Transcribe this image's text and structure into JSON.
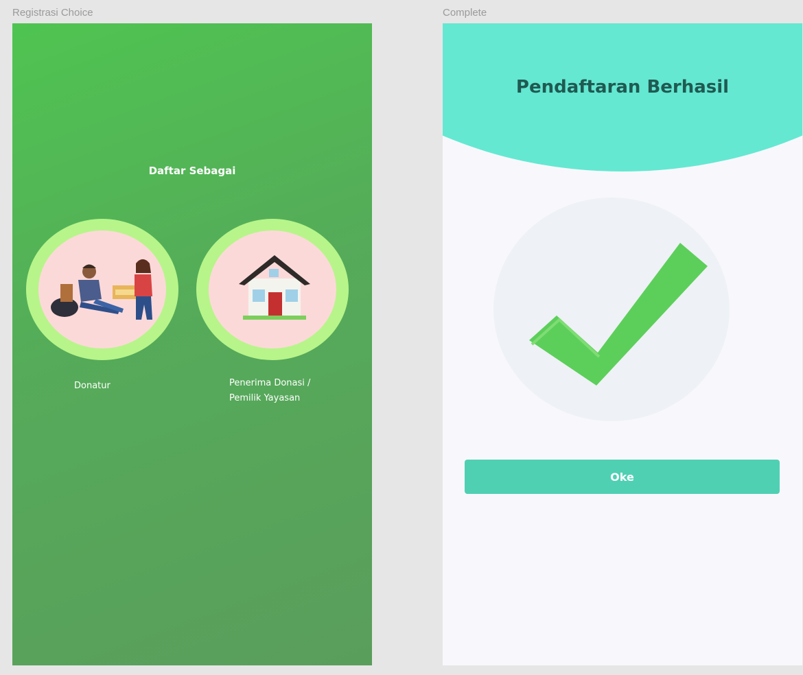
{
  "artboards": {
    "left_label": "Registrasi  Choice",
    "right_label": "Complete"
  },
  "registration_choice": {
    "title": "Daftar Sebagai",
    "options": [
      {
        "label": "Donatur",
        "icon": "donation-people-illustration"
      },
      {
        "label_line1": "Penerima Donasi /",
        "label_line2": "Pemilik Yayasan",
        "icon": "house-illustration"
      }
    ]
  },
  "complete": {
    "title": "Pendaftaran Berhasil",
    "icon": "checkmark-icon",
    "button_label": "Oke"
  },
  "colors": {
    "left_bg_top": "#4fc451",
    "left_bg_bottom": "#5a9e5c",
    "ring": "#b7f58a",
    "ring_inner": "#fcd9d9",
    "header_blob": "#64e8d2",
    "title_text": "#1f5a52",
    "check": "#5ccf5a",
    "button": "#4fd0b3"
  }
}
